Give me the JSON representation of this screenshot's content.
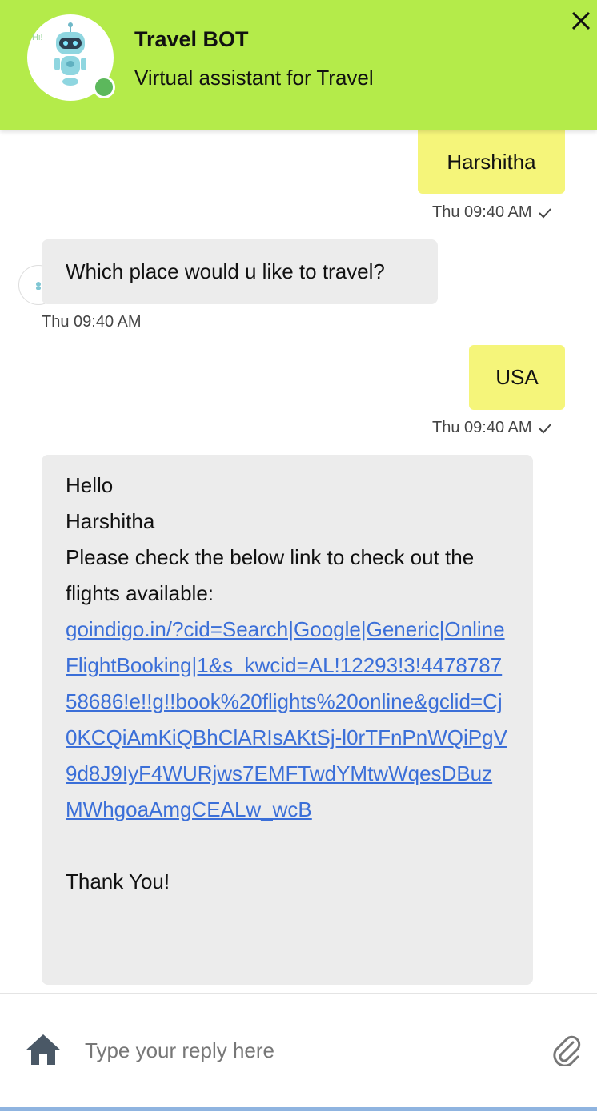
{
  "header": {
    "title": "Travel BOT",
    "subtitle": "Virtual assistant for Travel",
    "status_color": "#5cb85c",
    "accent_color": "#b4eb4a"
  },
  "messages": [
    {
      "sender": "user",
      "text": "Harshitha",
      "timestamp": "Thu 09:40 AM",
      "read": true
    },
    {
      "sender": "bot",
      "text": "Which place would u like to travel?",
      "timestamp": "Thu 09:40 AM"
    },
    {
      "sender": "user",
      "text": "USA",
      "timestamp": "Thu 09:40 AM",
      "read": true
    },
    {
      "sender": "bot",
      "lines": [
        "Hello",
        "Harshitha",
        "Please check the below link to check out the flights available:"
      ],
      "link": "goindigo.in/?cid=Search|Google|Generic|OnlineFlightBooking|1&s_kwcid=AL!12293!3!447878758686!e!!g!!book%20flights%20online&gclid=Cj0KCQiAmKiQBhClARIsAKtSj-l0rTFnPnWQiPgV9d8J9IyF4WURjws7EMFTwdYMtwWqesDBuzMWhgoaAmgCEALw_wcB",
      "closing": "Thank You!"
    }
  ],
  "composer": {
    "placeholder": "Type your reply here",
    "home_icon": "home-icon",
    "attach_icon": "paperclip-icon"
  }
}
